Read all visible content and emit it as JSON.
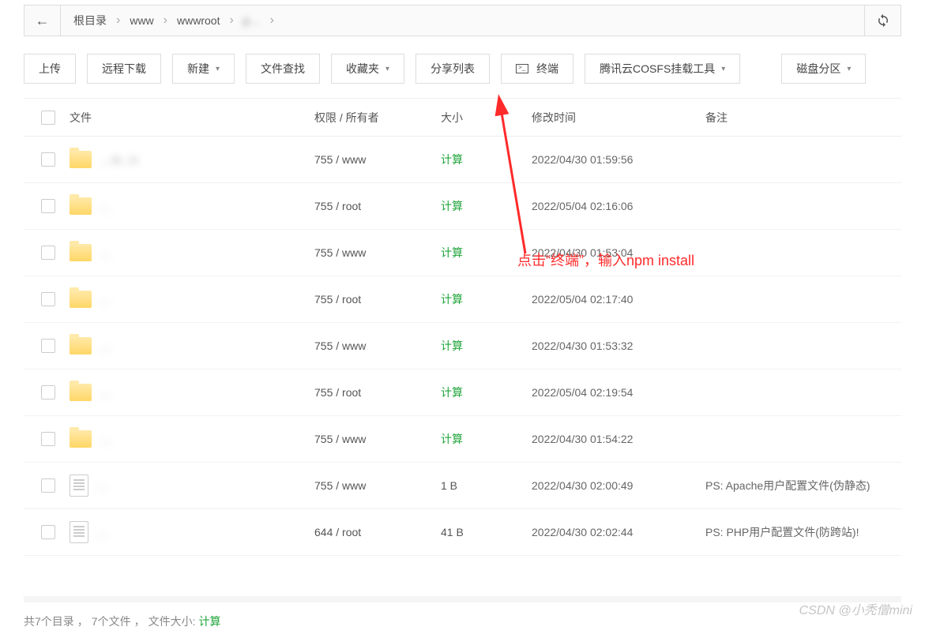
{
  "path": {
    "back_icon": "←",
    "crumbs": [
      "根目录",
      "www",
      "wwwroot"
    ],
    "crumb_blur": "p…",
    "refresh_icon": "refresh"
  },
  "toolbar": {
    "upload": "上传",
    "remote_download": "远程下载",
    "new": "新建",
    "file_search": "文件查找",
    "favorites": "收藏夹",
    "share_list": "分享列表",
    "terminal": "终端",
    "cosfs": "腾讯云COSFS挂载工具",
    "disk_partition": "磁盘分区"
  },
  "columns": {
    "name": "文件",
    "perm_owner": "权限 / 所有者",
    "size": "大小",
    "mtime": "修改时间",
    "remark": "备注"
  },
  "calc_label": "计算",
  "rows": [
    {
      "type": "folder",
      "name_blur": "…-k…n",
      "perm": "755 / www",
      "size": "计算",
      "mtime": "2022/04/30 01:59:56",
      "remark": ""
    },
    {
      "type": "folder",
      "name_blur": "…",
      "perm": "755 / root",
      "size": "计算",
      "mtime": "2022/05/04 02:16:06",
      "remark": ""
    },
    {
      "type": "folder",
      "name_blur": "…",
      "perm": "755 / www",
      "size": "计算",
      "mtime": "2022/04/30 01:53:04",
      "remark": ""
    },
    {
      "type": "folder",
      "name_blur": "…",
      "perm": "755 / root",
      "size": "计算",
      "mtime": "2022/05/04 02:17:40",
      "remark": ""
    },
    {
      "type": "folder",
      "name_blur": "…",
      "perm": "755 / www",
      "size": "计算",
      "mtime": "2022/04/30 01:53:32",
      "remark": ""
    },
    {
      "type": "folder",
      "name_blur": "…",
      "perm": "755 / root",
      "size": "计算",
      "mtime": "2022/05/04 02:19:54",
      "remark": ""
    },
    {
      "type": "folder",
      "name_blur": "…",
      "perm": "755 / www",
      "size": "计算",
      "mtime": "2022/04/30 01:54:22",
      "remark": ""
    },
    {
      "type": "file",
      "name_blur": "…",
      "perm": "755 / www",
      "size": "1 B",
      "mtime": "2022/04/30 02:00:49",
      "remark": "PS: Apache用户配置文件(伪静态)"
    },
    {
      "type": "file",
      "name_blur": "…",
      "perm": "644 / root",
      "size": "41 B",
      "mtime": "2022/04/30 02:02:44",
      "remark": "PS: PHP用户配置文件(防跨站)!"
    }
  ],
  "annotation": "点击“终端”，输入npm install",
  "footer": {
    "dirs": "共7个目录",
    "files": "7个文件",
    "size_label": "文件大小:",
    "size_calc": "计算"
  },
  "watermark": "CSDN @小秃僧mini"
}
